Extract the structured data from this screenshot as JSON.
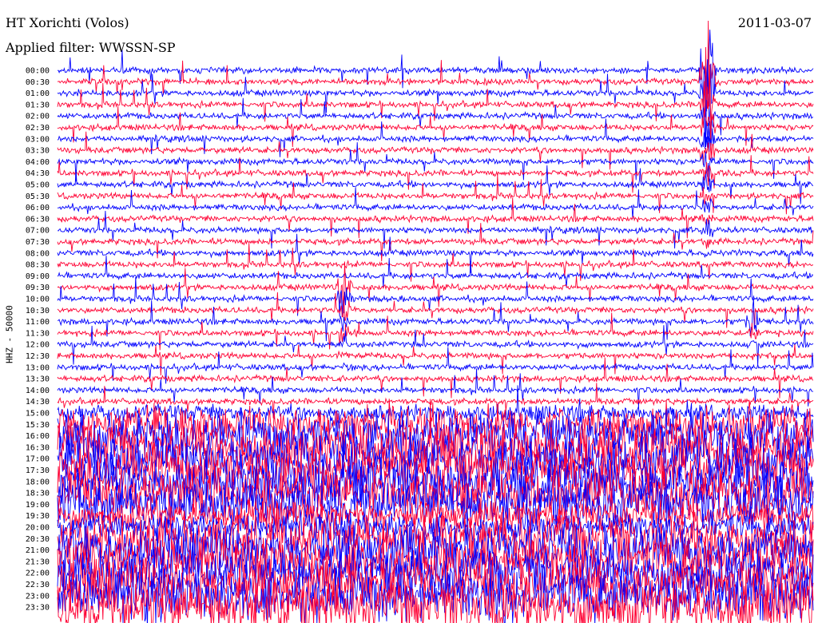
{
  "header": {
    "station": "HT Xorichti (Volos)",
    "date": "2011-03-07",
    "filter": "Applied filter: WWSSN-SP"
  },
  "chart_data": {
    "type": "line",
    "title": "HT Xorichti (Volos)",
    "subtitle": "Applied filter: WWSSN-SP",
    "date": "2011-03-07",
    "ylabel": "HHZ - 50000",
    "xlabel": "",
    "trace_colors": [
      "#0000ff",
      "#ff0033"
    ],
    "rows": [
      "00:00",
      "00:30",
      "01:00",
      "01:30",
      "02:00",
      "02:30",
      "03:00",
      "03:30",
      "04:00",
      "04:30",
      "05:00",
      "05:30",
      "06:00",
      "06:30",
      "07:00",
      "07:30",
      "08:00",
      "08:30",
      "09:00",
      "09:30",
      "10:00",
      "10:30",
      "11:00",
      "11:30",
      "12:00",
      "12:30",
      "13:00",
      "13:30",
      "14:00",
      "14:30",
      "15:00",
      "15:30",
      "16:00",
      "16:30",
      "17:00",
      "17:30",
      "18:00",
      "18:30",
      "19:00",
      "19:30",
      "20:00",
      "20:30",
      "21:00",
      "21:30",
      "22:00",
      "22:30",
      "23:00",
      "23:30"
    ],
    "noise_amplitude": [
      3,
      3,
      3,
      3,
      3,
      3,
      3,
      3,
      3,
      3,
      3,
      3,
      3,
      3,
      3,
      3,
      3,
      3,
      3,
      3,
      3,
      3,
      3,
      3,
      3,
      3,
      3,
      3,
      3,
      3,
      8,
      18,
      24,
      24,
      24,
      24,
      24,
      24,
      24,
      14,
      14,
      24,
      24,
      24,
      24,
      24,
      26,
      26
    ],
    "events": [
      {
        "row": 0,
        "time_fraction": 0.86,
        "peak_amplitude": 95,
        "duration_rows": 18
      },
      {
        "row": 19,
        "time_fraction": 0.38,
        "peak_amplitude": 40,
        "duration_rows": 9
      },
      {
        "row": 22,
        "time_fraction": 0.92,
        "peak_amplitude": 22,
        "duration_rows": 4
      },
      {
        "row": 38,
        "time_fraction": 0.0,
        "peak_amplitude": 18,
        "duration_rows": 1
      }
    ]
  }
}
